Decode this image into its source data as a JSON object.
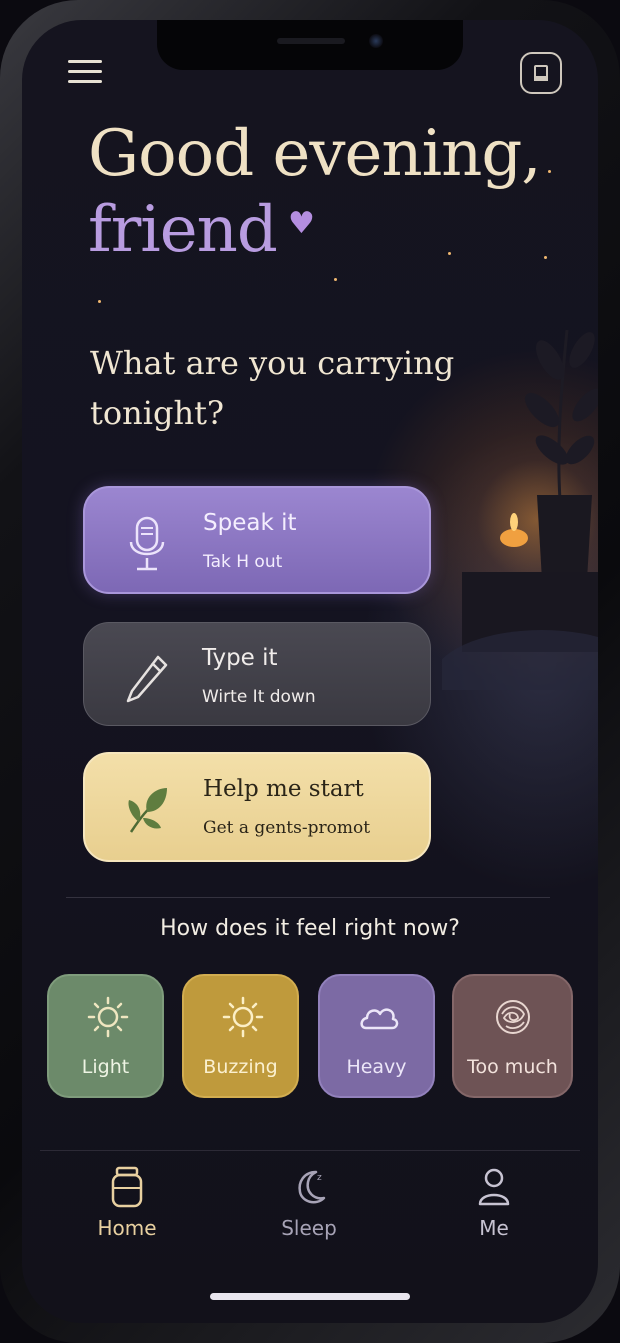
{
  "header": {
    "greeting_line1": "Good evening,",
    "greeting_line2": "friend",
    "heart": "♥",
    "question": "What are you carrying tonight?"
  },
  "actions": [
    {
      "title": "Speak it",
      "subtitle": "Tak H out",
      "icon": "microphone-icon"
    },
    {
      "title": "Type it",
      "subtitle": "Wirte It down",
      "icon": "pencil-icon"
    },
    {
      "title": "Help me start",
      "subtitle": "Get a gents-promot",
      "icon": "leaf-icon"
    }
  ],
  "mood": {
    "question": "How does it feel right now?",
    "options": [
      {
        "label": "Light",
        "icon": "sun-icon",
        "color": "#6c8a6a"
      },
      {
        "label": "Buzzing",
        "icon": "sun-icon",
        "color": "#bf9a3c"
      },
      {
        "label": "Heavy",
        "icon": "cloud-icon",
        "color": "#7c6aa4"
      },
      {
        "label": "Too much",
        "icon": "tangle-icon",
        "color": "#6e5355"
      }
    ]
  },
  "nav": {
    "items": [
      {
        "label": "Home",
        "icon": "jar-icon",
        "active": true
      },
      {
        "label": "Sleep",
        "icon": "moon-icon",
        "active": false
      },
      {
        "label": "Me",
        "icon": "person-icon",
        "active": false
      }
    ]
  },
  "colors": {
    "background": "#14131e",
    "accent_purple": "#b89ce0",
    "accent_cream": "#efe1c4",
    "speak_button": "#8c77c4",
    "type_button": "#424149",
    "help_button": "#eed69c"
  }
}
